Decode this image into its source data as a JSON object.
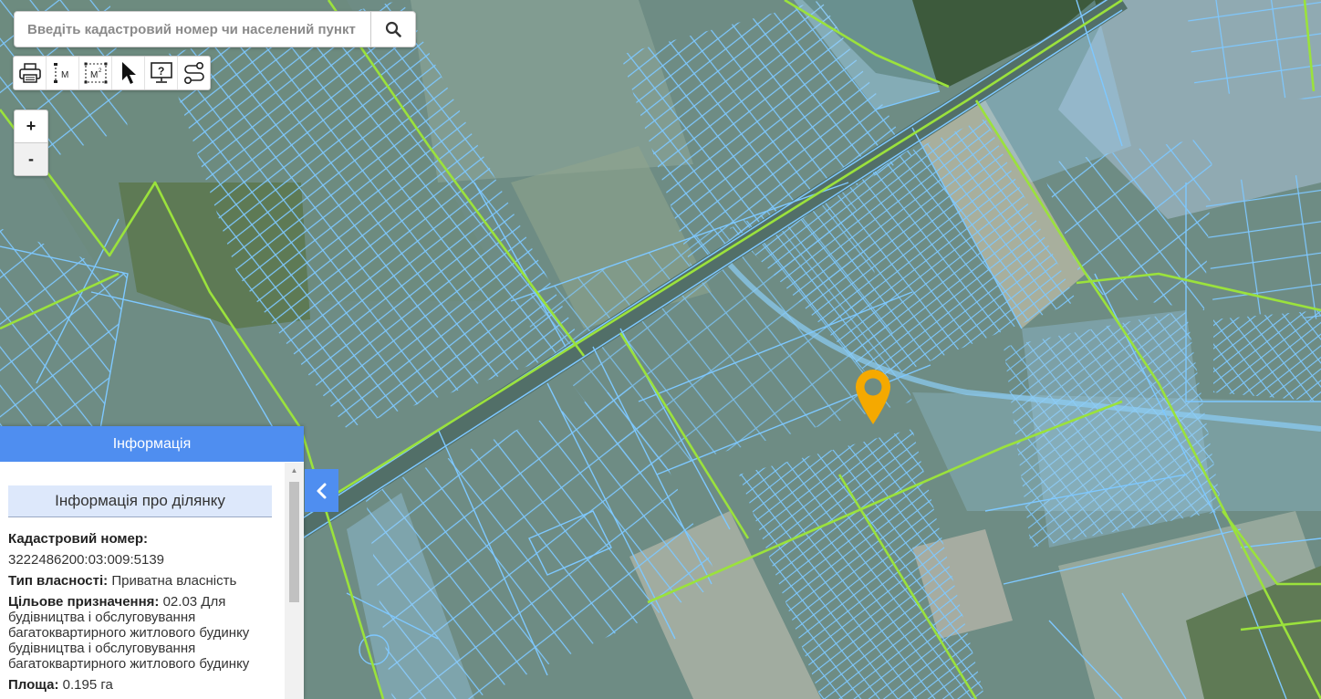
{
  "search": {
    "placeholder": "Введіть кадастровий номер чи населений пункт",
    "icon": "search-icon"
  },
  "toolbar": {
    "items": [
      {
        "name": "print-icon"
      },
      {
        "name": "measure-length-icon",
        "label": "M"
      },
      {
        "name": "measure-area-icon",
        "label": "M²"
      },
      {
        "name": "pointer-icon"
      },
      {
        "name": "help-icon",
        "label": "?"
      },
      {
        "name": "route-icon"
      }
    ]
  },
  "zoom": {
    "in": "+",
    "out": "-"
  },
  "panel": {
    "title": "Інформація",
    "section_title": "Інформація про ділянку",
    "cadastral_label": "Кадастровий номер:",
    "cadastral_value": "3222486200:03:009:5139",
    "ownership_label": "Тип власності:",
    "ownership_value": "Приватна власність",
    "purpose_label": "Цільове призначення:",
    "purpose_value": "02.03 Для будівництва і обслуговування багатоквартирного житлового будинку будівництва і обслуговування багатоквартирного житлового будинку",
    "area_label": "Площа:",
    "area_value": "0.195 га"
  },
  "colors": {
    "accent": "#4f8ef0",
    "parcel_line": "#7ec8ff",
    "boundary_line": "#9be23c",
    "marker": "#f5a900"
  }
}
